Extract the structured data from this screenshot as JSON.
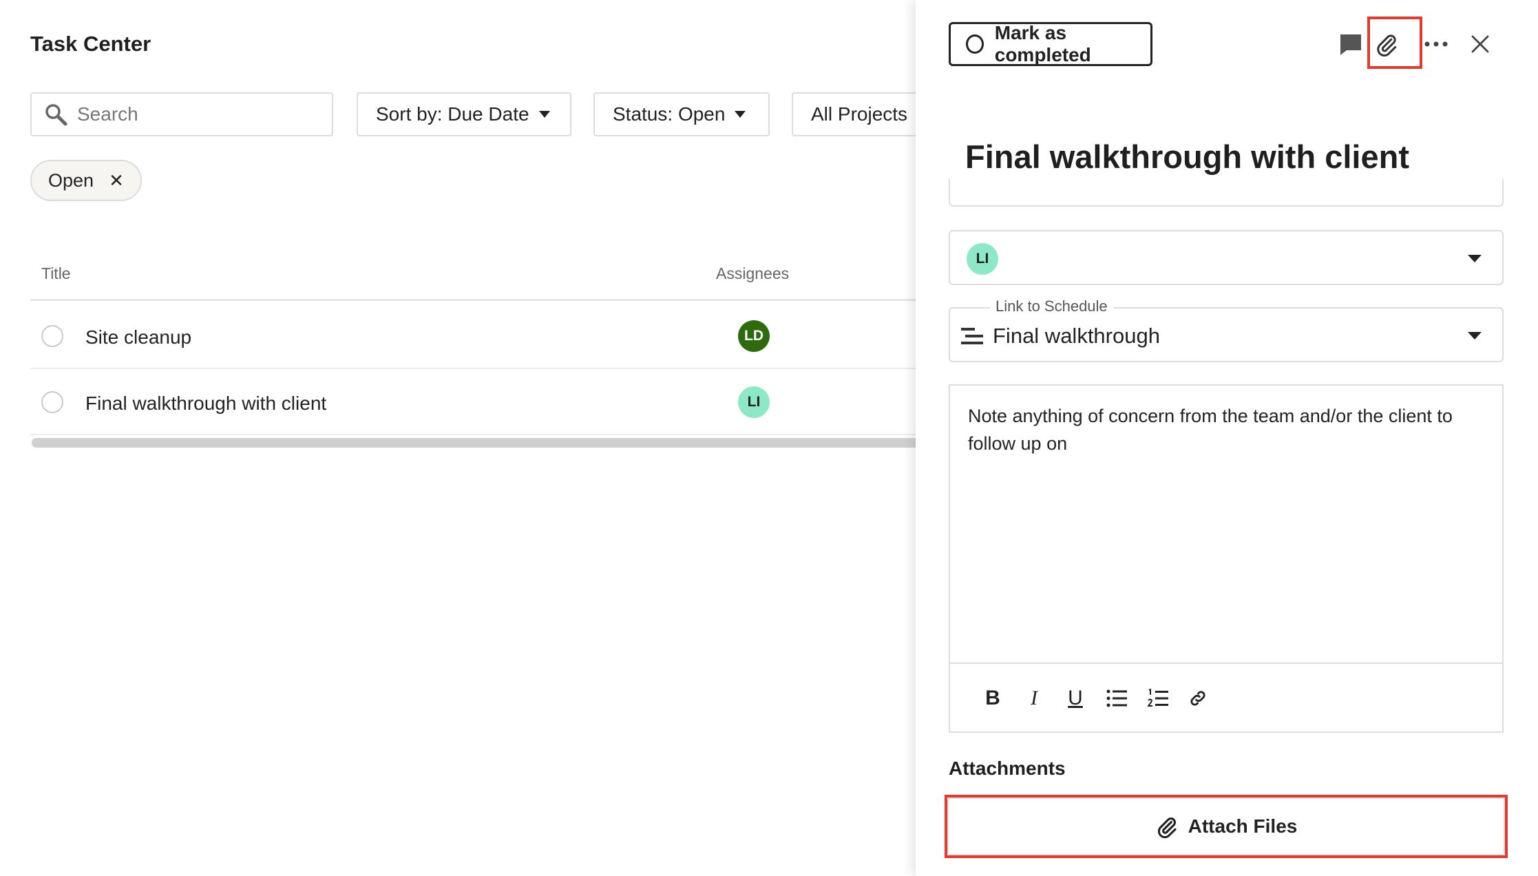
{
  "task_center": {
    "title": "Task Center",
    "search": {
      "placeholder": "Search"
    },
    "filters": {
      "sort_label": "Sort by: Due Date",
      "status_label": "Status: Open",
      "project_label": "All Projects"
    },
    "active_chip": {
      "label": "Open",
      "remove": "✕"
    },
    "columns": {
      "title": "Title",
      "assignees": "Assignees"
    },
    "rows": [
      {
        "title": "Site cleanup",
        "assignee_initials": "LD",
        "assignee_color": "#2e6b0f",
        "assignee_text_color": "#ffffff"
      },
      {
        "title": "Final walkthrough with client",
        "assignee_initials": "LI",
        "assignee_color": "#8de8c8",
        "assignee_text_color": "#1f1f1f"
      }
    ]
  },
  "task_panel": {
    "mark_completed_label": "Mark as completed",
    "toolbar_icons": [
      "comment-icon",
      "paperclip-icon",
      "more-icon",
      "close-icon"
    ],
    "title": "Final walkthrough with client",
    "assignee": {
      "initials": "LI",
      "color": "#8de8c8"
    },
    "schedule": {
      "legend": "Link to Schedule",
      "value": "Final walkthrough"
    },
    "notes": "Note anything of concern from the team and/or the client to follow up on",
    "editor_tools": {
      "bold": "B",
      "italic": "I",
      "underline": "U"
    },
    "attachments": {
      "heading": "Attachments",
      "button_label": "Attach Files"
    }
  },
  "colors": {
    "highlight": "#e23a2c",
    "border": "#dcdcdc",
    "text": "#222222"
  }
}
